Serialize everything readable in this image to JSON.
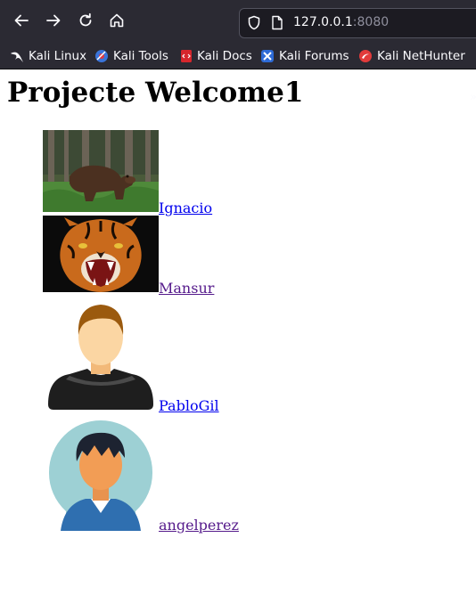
{
  "browser": {
    "url_host": "127.0.0.1",
    "url_port": ":8080",
    "nav_icons": [
      "back-arrow-icon",
      "forward-arrow-icon",
      "reload-icon",
      "home-icon"
    ],
    "bookmarks": [
      {
        "label": "Kali Linux",
        "icon": "kali-dragon-icon"
      },
      {
        "label": "Kali Tools",
        "icon": "kali-tools-icon"
      },
      {
        "label": "Kali Docs",
        "icon": "kali-docs-icon"
      },
      {
        "label": "Kali Forums",
        "icon": "kali-forums-icon"
      },
      {
        "label": "Kali NetHunter",
        "icon": "kali-nethunter-icon"
      }
    ]
  },
  "page": {
    "title": "Projecte Welcome1",
    "users": [
      {
        "name": "Ignacio",
        "image": "brown-bear-photo",
        "link_state": "unvisited"
      },
      {
        "name": "Mansur",
        "image": "roaring-tiger-photo",
        "link_state": "visited"
      },
      {
        "name": "PabloGil",
        "image": "male-avatar-illustration",
        "link_state": "unvisited"
      },
      {
        "name": "angelperez",
        "image": "round-avatar-illustration",
        "link_state": "visited"
      }
    ]
  },
  "colors": {
    "toolbar_bg": "#2b2a33",
    "urlbar_bg": "#1c1b22",
    "link_unvisited": "#0000ee",
    "link_visited": "#551a8b"
  }
}
